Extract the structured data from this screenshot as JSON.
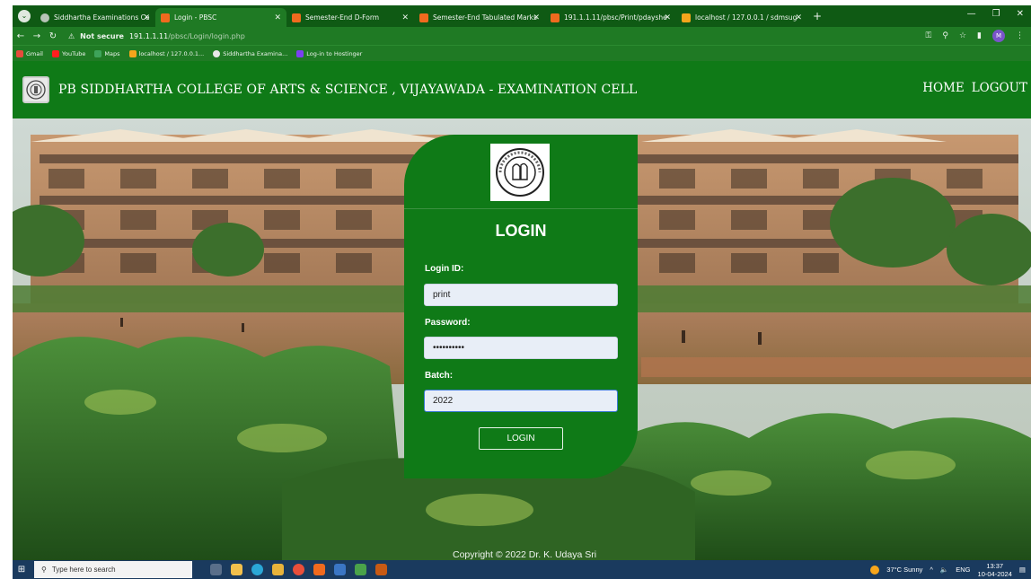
{
  "browser": {
    "tabs": [
      {
        "title": "Siddhartha Examinations Cell",
        "active": false
      },
      {
        "title": "Login - PBSC",
        "active": true
      },
      {
        "title": "Semester-End D-Form",
        "active": false
      },
      {
        "title": "Semester-End Tabulated Marks",
        "active": false
      },
      {
        "title": "191.1.1.11/pbsc/Print/pdayshe",
        "active": false
      },
      {
        "title": "localhost / 127.0.0.1 / sdmsug",
        "active": false
      }
    ],
    "tab_close": "✕",
    "new_tab": "+",
    "warning": "Not secure",
    "url_host": "191.1.1.11",
    "url_path": "/pbsc/Login/login.php",
    "avatar_initial": "M",
    "bookmarks": [
      "Gmail",
      "YouTube",
      "Maps",
      "localhost / 127.0.0.1...",
      "Siddhartha Examina...",
      "Log-in to Hostinger"
    ]
  },
  "site": {
    "title": "PB SIDDHARTHA COLLEGE OF ARTS & SCIENCE , VIJAYAWADA - EXAMINATION CELL",
    "nav": {
      "home": "HOME",
      "logout": "LOGOUT"
    },
    "copyright": "Copyright © 2022 Dr. K. Udaya Sri"
  },
  "login": {
    "title": "LOGIN",
    "login_id_label": "Login ID:",
    "login_id_value": "print",
    "password_label": "Password:",
    "password_value": "••••••••••",
    "batch_label": "Batch:",
    "batch_value": "2022",
    "button_label": "LOGIN"
  },
  "taskbar": {
    "search_placeholder": "Type here to search",
    "weather": "37°C  Sunny",
    "lang": "ENG",
    "time": "13:37",
    "date": "10-04-2024"
  },
  "colors": {
    "header_green": "#0f7a17",
    "chrome_green": "#1f7a24",
    "tab_green": "#0f5a14",
    "taskbar": "#1a3a5e"
  }
}
